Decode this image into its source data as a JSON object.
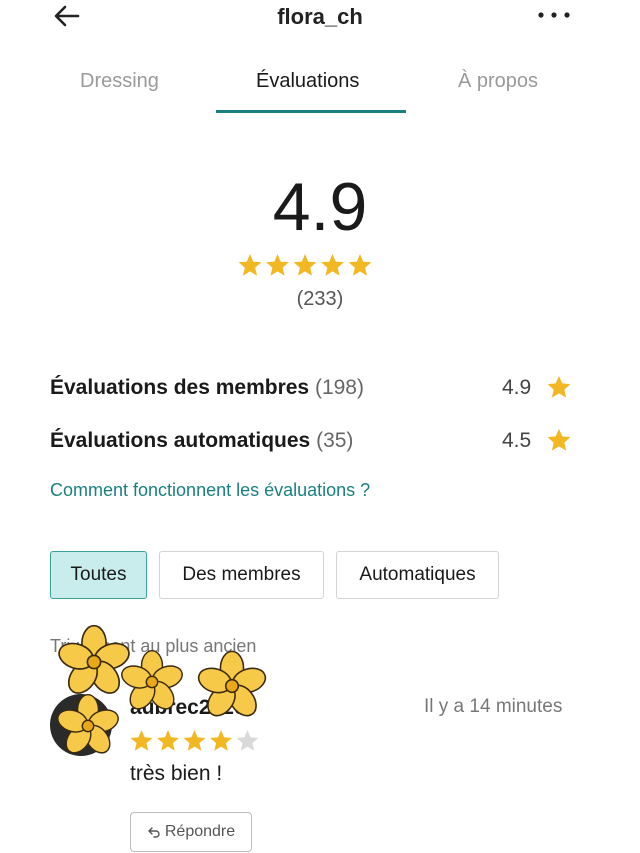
{
  "header": {
    "title": "flora_ch",
    "back_icon": "arrow-left-icon",
    "more_icon": "more-dots-icon"
  },
  "tabs": [
    {
      "label": "Dressing",
      "active": false
    },
    {
      "label": "Évaluations",
      "active": true
    },
    {
      "label": "À propos",
      "active": false
    }
  ],
  "summary": {
    "score": "4.9",
    "stars": 5,
    "count": "(233)"
  },
  "breakdown": [
    {
      "label": "Évaluations des membres",
      "count": "(198)",
      "score": "4.9"
    },
    {
      "label": "Évaluations automatiques",
      "count": "(35)",
      "score": "4.5"
    }
  ],
  "how_link": "Comment fonctionnent les évaluations ?",
  "filters": [
    {
      "label": "Toutes",
      "active": true
    },
    {
      "label": "Des membres",
      "active": false
    },
    {
      "label": "Automatiques",
      "active": false
    }
  ],
  "sort_label": "Tri : récent au plus ancien",
  "review": {
    "reviewer": "aubrec2020",
    "time": "Il y a 14 minutes",
    "rating": 4,
    "text": "très bien !",
    "reply_label": "Répondre",
    "reply_icon": "reply-arrow-icon"
  },
  "colors": {
    "accent": "#1a7f80",
    "star": "#f2b824",
    "star_empty": "#d9d9d9",
    "filter_active_bg": "#c9ecec",
    "flower": "#f7c948"
  }
}
